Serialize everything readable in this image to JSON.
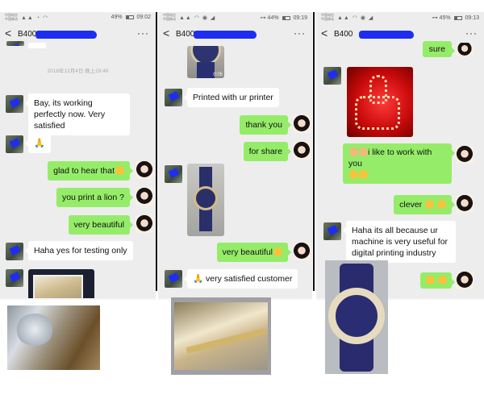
{
  "phones": [
    {
      "status": {
        "carrier_line1": "中国电信",
        "carrier_line2": "中国移动",
        "signal_icons": "▲▲ ◔ ◠",
        "battery": "49%",
        "time": "09:02"
      },
      "header": {
        "back_label": "<",
        "title": "B400",
        "more_label": "···"
      },
      "timestamp": "2018年12月4日 晚上19:49",
      "messages": [
        {
          "from": "customer",
          "text": "Bay, its working perfectly now. Very satisfied"
        },
        {
          "from": "customer",
          "text": "🙏"
        },
        {
          "from": "me",
          "text": "glad to hear that"
        },
        {
          "from": "me",
          "text": "you print a lion ?"
        },
        {
          "from": "me",
          "text": "very beautiful"
        },
        {
          "from": "customer",
          "text": "Haha yes for testing only"
        },
        {
          "from": "customer",
          "image": "bridge-print-photo"
        }
      ],
      "input": {
        "emoji_label": "☺",
        "plus_label": "+"
      },
      "overlay_image": "lion-print-photo"
    },
    {
      "status": {
        "carrier_line1": "中国电信",
        "carrier_line2": "中国移动",
        "signal_icons": "▲▲ ◠ ◉ ◢",
        "battery": "44%",
        "time": "09:19"
      },
      "header": {
        "back_label": "<",
        "title": "B400",
        "more_label": "···"
      },
      "messages": [
        {
          "from": "customer",
          "image": "watch-video",
          "duration": "0:05"
        },
        {
          "from": "customer",
          "text": "Printed with ur printer"
        },
        {
          "from": "me",
          "text": "thank you"
        },
        {
          "from": "me",
          "text": "for share"
        },
        {
          "from": "customer",
          "image": "watch-photo"
        },
        {
          "from": "me",
          "text": "very beautiful"
        },
        {
          "from": "customer",
          "text": "🙏 very satisfied customer"
        }
      ],
      "input": {
        "emoji_label": "☺",
        "plus_label": "+"
      },
      "overlay_image": "bridge-print-photo"
    },
    {
      "status": {
        "carrier_line1": "中国电信",
        "carrier_line2": "中国移动",
        "signal_icons": "▲▲ ◠ ◉ ◢",
        "battery": "45%",
        "time": "09:13"
      },
      "header": {
        "back_label": "<",
        "title": "B400",
        "more_label": "···"
      },
      "messages": [
        {
          "from": "me",
          "text": "sure"
        },
        {
          "from": "customer",
          "image": "led-thumbs-up"
        },
        {
          "from": "me",
          "text": "i like to work with you"
        },
        {
          "from": "me",
          "text": "clever"
        },
        {
          "from": "customer",
          "text": "Haha its all because ur machine is very useful for digital printing industry"
        },
        {
          "from": "me",
          "text": ""
        }
      ],
      "input": {
        "emoji_label": "☺",
        "plus_label": "+"
      },
      "overlay_image": "marc-jacobs-watch-photo"
    }
  ]
}
